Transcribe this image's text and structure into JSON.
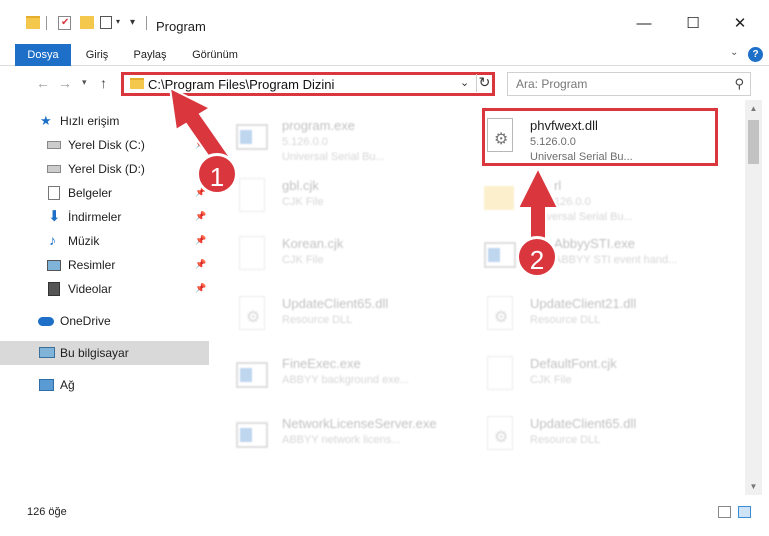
{
  "window": {
    "title": "Program",
    "minimize_glyph": "—",
    "maximize_glyph": "☐",
    "close_glyph": "✕"
  },
  "ribbon": {
    "tabs": [
      {
        "label": "Dosya",
        "active": true
      },
      {
        "label": "Giriş",
        "active": false
      },
      {
        "label": "Paylaş",
        "active": false
      },
      {
        "label": "Görünüm",
        "active": false
      }
    ],
    "help_glyph": "?"
  },
  "address": {
    "path": "C:\\Program Files\\Program Dizini",
    "search_placeholder": "Ara: Program"
  },
  "sidebar": {
    "items": [
      {
        "label": "Hızlı erişim",
        "icon": "star-icon",
        "pinned": false
      },
      {
        "label": "Yerel Disk (C:)",
        "icon": "drive-icon",
        "pinned": true
      },
      {
        "label": "Yerel Disk (D:)",
        "icon": "drive-icon",
        "pinned": true
      },
      {
        "label": "Belgeler",
        "icon": "documents-icon",
        "pinned": true
      },
      {
        "label": "İndirmeler",
        "icon": "download-icon",
        "pinned": true
      },
      {
        "label": "Müzik",
        "icon": "music-icon",
        "pinned": true
      },
      {
        "label": "Resimler",
        "icon": "pictures-icon",
        "pinned": true
      },
      {
        "label": "Videolar",
        "icon": "video-icon",
        "pinned": true
      },
      {
        "label": "OneDrive",
        "icon": "cloud-icon",
        "pinned": false
      },
      {
        "label": "Bu bilgisayar",
        "icon": "computer-icon",
        "pinned": false,
        "selected": true
      },
      {
        "label": "Ağ",
        "icon": "network-icon",
        "pinned": false
      }
    ]
  },
  "files": [
    {
      "name": "program.exe",
      "line2": "5.126.0.0",
      "line3": "Universal Serial Bu...",
      "icon": "exe-icon",
      "highlighted": false
    },
    {
      "name": "phvfwext.dll",
      "line2": "5.126.0.0",
      "line3": "Universal Serial Bu...",
      "icon": "dll-icon",
      "highlighted": true
    },
    {
      "name": "gbl.cjk",
      "line2": "CJK File",
      "line3": "",
      "icon": "file-icon",
      "highlighted": false
    },
    {
      "name": "rl",
      "line2": "126.0.0",
      "line3": "Universal Serial Bu...",
      "icon": "folder-icon",
      "highlighted": false
    },
    {
      "name": "Korean.cjk",
      "line2": "CJK File",
      "line3": "",
      "icon": "file-icon",
      "highlighted": false
    },
    {
      "name": "AbbyySTI.exe",
      "line2": "ABBYY STI event hand...",
      "line3": "",
      "icon": "exe-icon",
      "highlighted": false
    },
    {
      "name": "UpdateClient65.dll",
      "line2": "Resource DLL",
      "line3": "",
      "icon": "dll-icon",
      "highlighted": false
    },
    {
      "name": "UpdateClient21.dll",
      "line2": "Resource DLL",
      "line3": "",
      "icon": "dll-icon",
      "highlighted": false
    },
    {
      "name": "FineExec.exe",
      "line2": "ABBYY background exe...",
      "line3": "",
      "icon": "exe-icon",
      "highlighted": false
    },
    {
      "name": "DefaultFont.cjk",
      "line2": "CJK File",
      "line3": "",
      "icon": "file-icon",
      "highlighted": false
    },
    {
      "name": "NetworkLicenseServer.exe",
      "line2": "ABBYY network licens...",
      "line3": "",
      "icon": "exe-icon",
      "highlighted": false
    },
    {
      "name": "UpdateClient65.dll",
      "line2": "Resource DLL",
      "line3": "",
      "icon": "dll-icon",
      "highlighted": false
    }
  ],
  "status": {
    "item_count": "126 öğe"
  },
  "annotations": {
    "badge1": "1",
    "badge2": "2",
    "accent_color": "#d9363e"
  },
  "colors": {
    "ribbon_active": "#1e6fc8",
    "selected_nav": "#d9d9d9"
  }
}
